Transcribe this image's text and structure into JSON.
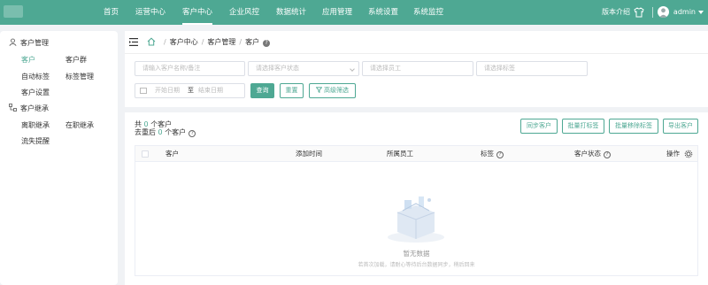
{
  "nav": {
    "items": [
      "首页",
      "运营中心",
      "客户中心",
      "企业风控",
      "数据统计",
      "应用管理",
      "系统设置",
      "系统监控"
    ],
    "active_index": 2,
    "version_label": "版本介绍",
    "user": "admin"
  },
  "sidebar": {
    "group1": "客户管理",
    "group1_links": [
      "客户",
      "客户群",
      "自动标签",
      "标签管理",
      "客户设置"
    ],
    "active_link": "客户",
    "group2": "客户继承",
    "group2_links": [
      "离职继承",
      "在职继承",
      "流失提醒"
    ]
  },
  "breadcrumb": {
    "items": [
      "客户中心",
      "客户管理",
      "客户"
    ],
    "separator": "/"
  },
  "filters": {
    "name_placeholder": "请输入客户名称/备注",
    "status_placeholder": "请选择客户状态",
    "staff_placeholder": "请选择员工",
    "tag_placeholder": "请选择标签",
    "start_date_placeholder": "开始日期",
    "date_separator": "至",
    "end_date_placeholder": "结束日期",
    "search_label": "查询",
    "reset_label": "重置",
    "advanced_label": "高级筛选"
  },
  "summary": {
    "total_prefix": "共",
    "total_count": "0",
    "total_suffix": "个客户",
    "dedup_prefix": "去重后",
    "dedup_count": "0",
    "dedup_suffix": "个客户"
  },
  "actions": [
    "同步客户",
    "批量打标签",
    "批量移除标签",
    "导出客户"
  ],
  "table": {
    "columns": [
      "客户",
      "添加时间",
      "所属员工",
      "标签",
      "客户状态",
      "操作"
    ],
    "empty_title": "暂无数据",
    "empty_subtitle": "若首次加载，请耐心等待后台数据同步，稍后回来"
  },
  "colors": {
    "accent": "#4ea893"
  }
}
